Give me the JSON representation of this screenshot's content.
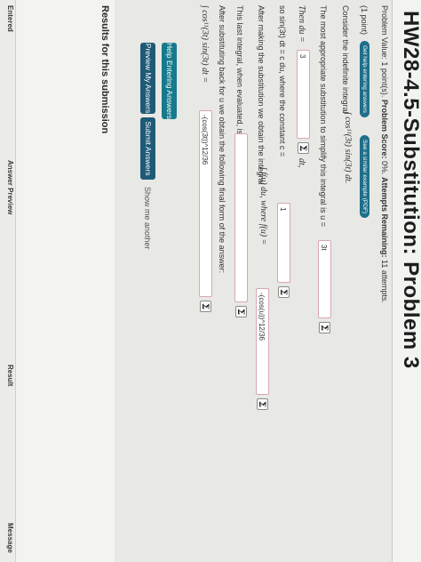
{
  "title": "HW28-4.5-Substitution: Problem 3",
  "info": {
    "problem_value_label": "Problem Value:",
    "problem_value": "1 point(s).",
    "problem_score_label": "Problem Score:",
    "problem_score": "0%.",
    "attempts_label": "Attempts Remaining:",
    "attempts": "11 attempts."
  },
  "question": {
    "points": "(1 point)",
    "help_entering": "Get help entering answers",
    "similar_example": "See a similar example (PDF)",
    "line1": "Consider the indefinite integral",
    "integrand1": "∫ cos¹¹(3t) sin(3t) dt.",
    "line2": "The most appropriate substitution to simplify this integral is u =",
    "answer_u": "3t",
    "then_du": "Then du =",
    "answer_du": "3",
    "dt_suffix": "dt,",
    "so_text": "so sin(3t) dt = c du, where the constant c =",
    "answer_c": "1",
    "after_sub": "After making the substitution we obtain the integral",
    "integral_fu": "∫ f(u) du, where f(u) =",
    "answer_fu": "-(cos(u))^12/36",
    "last_integral": "This last integral, when evaluated, is",
    "answer_eval": "",
    "after_back": "After substituting back for u we obtain the following final form of the answer:",
    "final_expr": "∫ cos¹¹(3t) sin(3t) dt =",
    "answer_final": "-(cos(3t))^12/36",
    "sigma": "Σ"
  },
  "buttons": {
    "help_entering": "Help Entering Answers",
    "preview": "Preview My Answers",
    "submit": "Submit Answers",
    "show_another": "Show me another"
  },
  "results": {
    "heading": "Results for this submission",
    "columns": [
      "Entered",
      "Answer Preview",
      "Result",
      "Message"
    ]
  }
}
